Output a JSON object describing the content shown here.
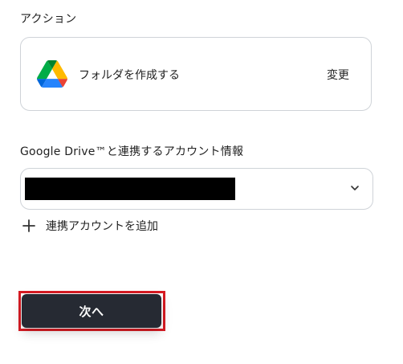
{
  "action_section": {
    "label": "アクション",
    "action_name": "フォルダを作成する",
    "change_label": "変更",
    "app_icon": "google-drive-icon"
  },
  "account_section": {
    "label": "Google Drive™と連携するアカウント情報",
    "selected_value_redacted": true,
    "dropdown_icon": "chevron-down-icon",
    "add_account_label": "連携アカウントを追加",
    "add_icon": "plus-icon"
  },
  "footer": {
    "next_label": "次へ",
    "highlight_color": "#d81b23",
    "button_color": "#262a33"
  }
}
